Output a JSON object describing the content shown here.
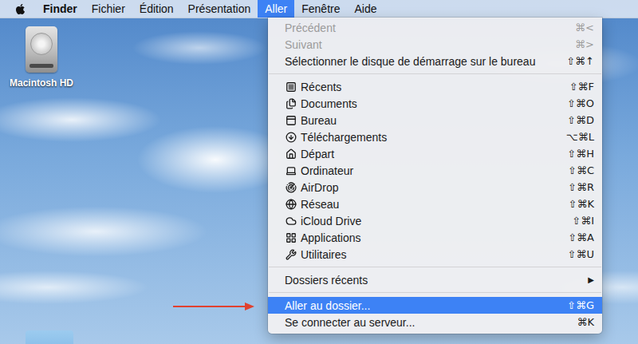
{
  "menu_bar": {
    "items": [
      {
        "label": "Finder",
        "kind": "app",
        "selected": false
      },
      {
        "label": "Fichier",
        "kind": "menu",
        "selected": false
      },
      {
        "label": "Édition",
        "kind": "menu",
        "selected": false
      },
      {
        "label": "Présentation",
        "kind": "menu",
        "selected": false
      },
      {
        "label": "Aller",
        "kind": "menu",
        "selected": true
      },
      {
        "label": "Fenêtre",
        "kind": "menu",
        "selected": false
      },
      {
        "label": "Aide",
        "kind": "menu",
        "selected": false
      }
    ]
  },
  "desktop": {
    "icons": [
      {
        "kind": "drive",
        "label": "Macintosh HD"
      },
      {
        "kind": "folder"
      }
    ]
  },
  "menu": {
    "items": [
      {
        "kind": "item",
        "label": "Précédent",
        "shortcut": "⌘<",
        "disabled": true,
        "selected": false
      },
      {
        "kind": "item",
        "label": "Suivant",
        "shortcut": "⌘>",
        "disabled": true,
        "selected": false
      },
      {
        "kind": "item",
        "label": "Sélectionner le disque de démarrage sur le bureau",
        "shortcut": "⇧⌘↑",
        "disabled": false,
        "selected": false
      },
      {
        "kind": "separator"
      },
      {
        "kind": "place",
        "label": "Récents",
        "shortcut": "⇧⌘F",
        "disabled": false,
        "selected": false
      },
      {
        "kind": "place",
        "label": "Documents",
        "shortcut": "⇧⌘O",
        "disabled": false,
        "selected": false
      },
      {
        "kind": "place",
        "label": "Bureau",
        "shortcut": "⇧⌘D",
        "disabled": false,
        "selected": false
      },
      {
        "kind": "place",
        "label": "Téléchargements",
        "shortcut": "⌥⌘L",
        "disabled": false,
        "selected": false
      },
      {
        "kind": "place",
        "label": "Départ",
        "shortcut": "⇧⌘H",
        "disabled": false,
        "selected": false
      },
      {
        "kind": "place",
        "label": "Ordinateur",
        "shortcut": "⇧⌘C",
        "disabled": false,
        "selected": false
      },
      {
        "kind": "place",
        "label": "AirDrop",
        "shortcut": "⇧⌘R",
        "disabled": false,
        "selected": false
      },
      {
        "kind": "place",
        "label": "Réseau",
        "shortcut": "⇧⌘K",
        "disabled": false,
        "selected": false
      },
      {
        "kind": "place",
        "label": "iCloud Drive",
        "shortcut": "⇧⌘I",
        "disabled": false,
        "selected": false
      },
      {
        "kind": "place",
        "label": "Applications",
        "shortcut": "⇧⌘A",
        "disabled": false,
        "selected": false
      },
      {
        "kind": "place",
        "label": "Utilitaires",
        "shortcut": "⇧⌘U",
        "disabled": false,
        "selected": false
      },
      {
        "kind": "separator"
      },
      {
        "kind": "submenu",
        "label": "Dossiers récents",
        "arrow": "▶",
        "disabled": false,
        "selected": false
      },
      {
        "kind": "separator"
      },
      {
        "kind": "item",
        "label": "Aller au dossier...",
        "shortcut": "⇧⌘G",
        "disabled": false,
        "selected": true
      },
      {
        "kind": "item",
        "label": "Se connecter au serveur...",
        "shortcut": "⌘K",
        "disabled": false,
        "selected": false
      }
    ]
  },
  "annotations": [
    {
      "kind": "arrow"
    }
  ]
}
